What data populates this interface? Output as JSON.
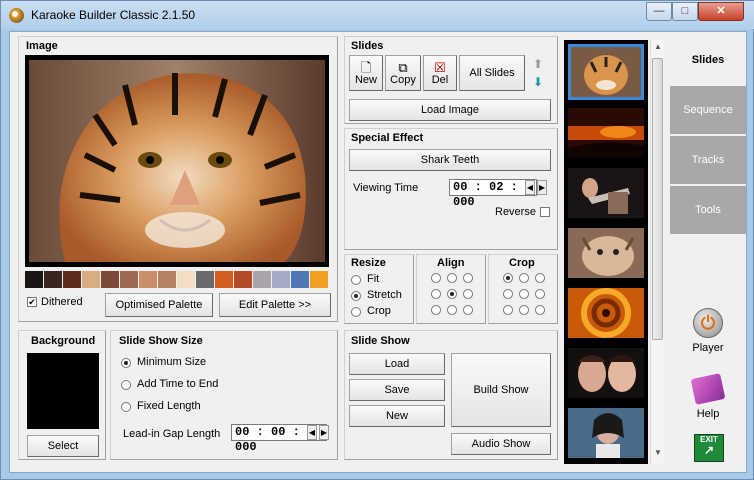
{
  "window": {
    "title": "Karaoke Builder Classic 2.1.50",
    "minimize": "—",
    "maximize": "□",
    "close": "✕"
  },
  "image_panel": {
    "label": "Image",
    "dithered_label": "Dithered",
    "dithered_checked": true,
    "optimised_palette": "Optimised Palette",
    "edit_palette": "Edit Palette >>",
    "palette": [
      "#1a1613",
      "#3a2620",
      "#5b2c1e",
      "#d9ac84",
      "#7a4a36",
      "#9c6a4e",
      "#c98f6c",
      "#b58260",
      "#f3dec4",
      "#6a6a6a",
      "#d35f20",
      "#b44a28",
      "#a8a4aa",
      "#a6aac6",
      "#4f78b6",
      "#f0a020"
    ]
  },
  "slides_panel": {
    "label": "Slides",
    "new": "New",
    "copy": "Copy",
    "del": "Del",
    "all_slides": "All Slides",
    "load_image": "Load Image"
  },
  "special_effect": {
    "label": "Special Effect",
    "effect": "Shark Teeth",
    "viewing_time_label": "Viewing Time",
    "viewing_time": "00 : 02 : 000",
    "reverse_label": "Reverse"
  },
  "resize": {
    "label": "Resize",
    "options": [
      "Fit",
      "Stretch",
      "Crop"
    ],
    "selected": "Stretch"
  },
  "align": {
    "label": "Align",
    "selected_index": 4
  },
  "crop": {
    "label": "Crop",
    "selected_index": 0
  },
  "background": {
    "label": "Background",
    "select": "Select"
  },
  "slide_show_size": {
    "label": "Slide Show Size",
    "options": [
      "Minimum Size",
      "Add Time to End",
      "Fixed Length"
    ],
    "selected": "Minimum Size",
    "lead_in_label": "Lead-in Gap Length",
    "lead_in": "00 : 00 : 000"
  },
  "slide_show": {
    "label": "Slide Show",
    "load": "Load",
    "save": "Save",
    "new": "New",
    "build_show": "Build Show",
    "audio_show": "Audio Show"
  },
  "tabs": [
    "Slides",
    "Sequence",
    "Tracks",
    "Tools"
  ],
  "active_tab": "Slides",
  "side_buttons": {
    "player": "Player",
    "help": "Help"
  },
  "exit_icon_text": "EXIT"
}
